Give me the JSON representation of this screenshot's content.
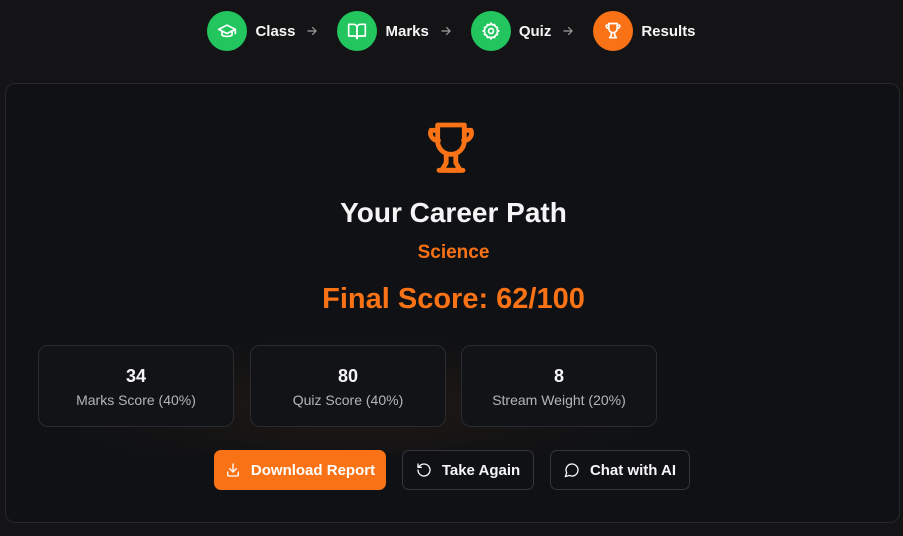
{
  "steps": [
    {
      "label": "Class",
      "icon": "graduation-cap-icon",
      "state": "done"
    },
    {
      "label": "Marks",
      "icon": "open-book-icon",
      "state": "done"
    },
    {
      "label": "Quiz",
      "icon": "gear-icon",
      "state": "done"
    },
    {
      "label": "Results",
      "icon": "trophy-icon",
      "state": "active"
    }
  ],
  "result": {
    "heading": "Your Career Path",
    "stream": "Science",
    "final_score": "Final Score: 62/100"
  },
  "stats": [
    {
      "value": "34",
      "label": "Marks Score (40%)"
    },
    {
      "value": "80",
      "label": "Quiz Score (40%)"
    },
    {
      "value": "8",
      "label": "Stream Weight (20%)"
    }
  ],
  "actions": {
    "download": "Download Report",
    "retake": "Take Again",
    "chat": "Chat with AI"
  },
  "colors": {
    "background": "#141416",
    "card": "#0f1114",
    "accent": "#f97316",
    "success": "#22c55e"
  }
}
